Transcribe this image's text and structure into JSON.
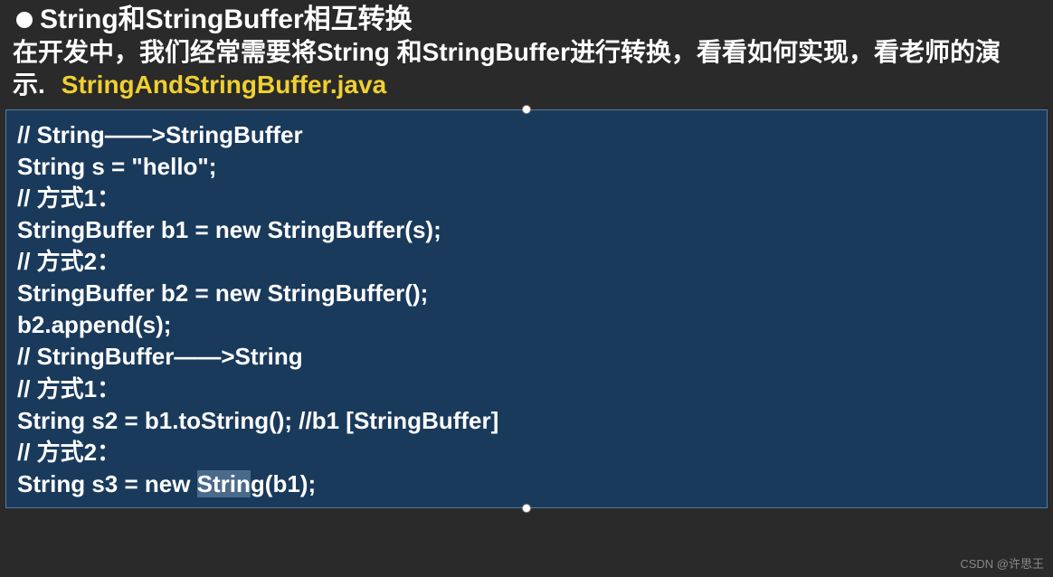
{
  "header": {
    "title": "String和StringBuffer相互转换",
    "subtitle_part1": "在开发中，我们经常需要将String 和StringBuffer进行转换，看看如何实现，看老师的演示.",
    "filename": "StringAndStringBuffer.java"
  },
  "code": {
    "lines": [
      "// String——>StringBuffer",
      "String s = \"hello\";",
      "// 方式1：",
      "StringBuffer b1 = new StringBuffer(s);",
      "// 方式2：",
      "StringBuffer b2 = new StringBuffer();",
      "b2.append(s);",
      "",
      "// StringBuffer——>String",
      "// 方式1：",
      "String s2 = b1.toString(); //b1 [StringBuffer]",
      "// 方式2：",
      "String s3 = new String(b1);"
    ],
    "highlighted_word": "Strin",
    "last_line_prefix": "String s3 = new ",
    "last_line_suffix": "g(b1);"
  },
  "watermark": "CSDN @许思王"
}
